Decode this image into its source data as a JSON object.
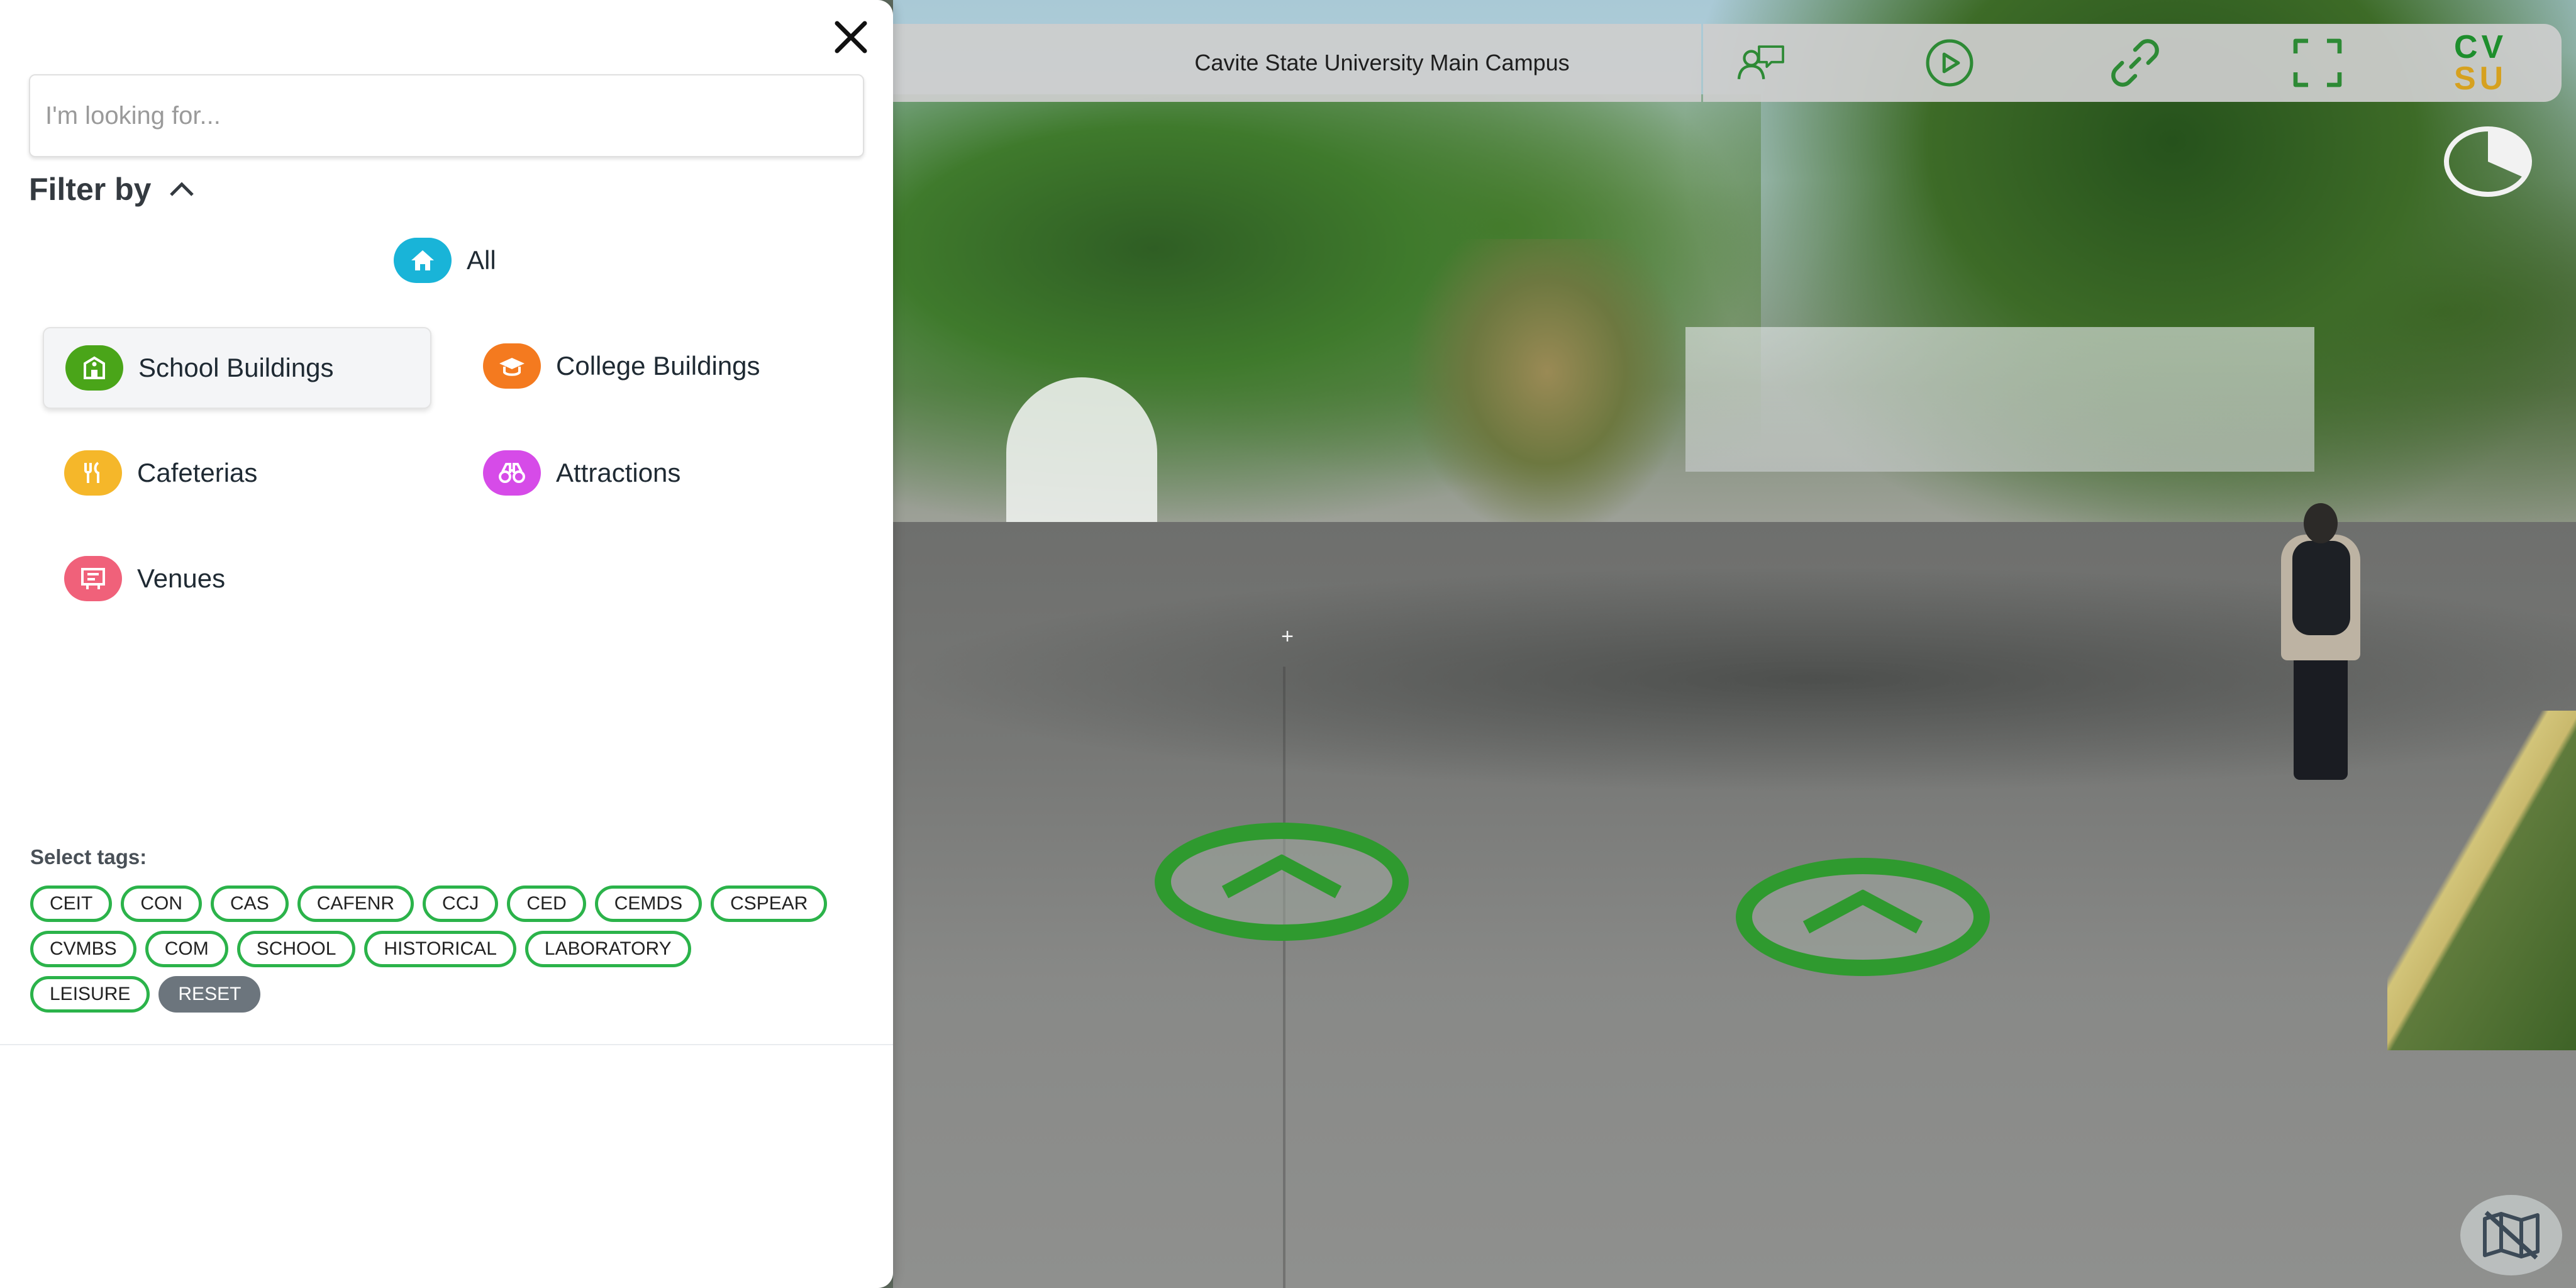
{
  "header": {
    "title": "Cavite State University Main Campus",
    "logo_line1": "CV",
    "logo_line2": "SU"
  },
  "toolbar": {
    "icons": [
      "guide-icon",
      "play-icon",
      "link-icon",
      "fullscreen-icon"
    ]
  },
  "viewer": {
    "crosshair": "+"
  },
  "panel": {
    "search_placeholder": "I'm looking for...",
    "filter_label": "Filter by",
    "categories": {
      "all": "All",
      "school_buildings": "School Buildings",
      "college_buildings": "College Buildings",
      "cafeterias": "Cafeterias",
      "attractions": "Attractions",
      "venues": "Venues"
    },
    "category_colors": {
      "all": "#19b4d8",
      "school_buildings": "#4aa519",
      "college_buildings": "#f47a1f",
      "cafeterias": "#f5b72a",
      "attractions": "#d64be8",
      "venues": "#f0617a"
    },
    "tags_label": "Select tags:",
    "tags_row1": [
      "CEIT",
      "CON",
      "CAS",
      "CAFENR",
      "CCJ",
      "CED",
      "CEMDS",
      "CSPEAR"
    ],
    "tags_row2": [
      "CVMBS",
      "COM",
      "SCHOOL",
      "HISTORICAL",
      "LABORATORY"
    ],
    "tags_row3": [
      "LEISURE"
    ],
    "reset_label": "RESET"
  },
  "colors": {
    "hotspot_ring": "#2f9a2f",
    "tag_border": "#2bb34a",
    "logo_green": "#1d8e2c",
    "logo_gold": "#d6a11f"
  }
}
